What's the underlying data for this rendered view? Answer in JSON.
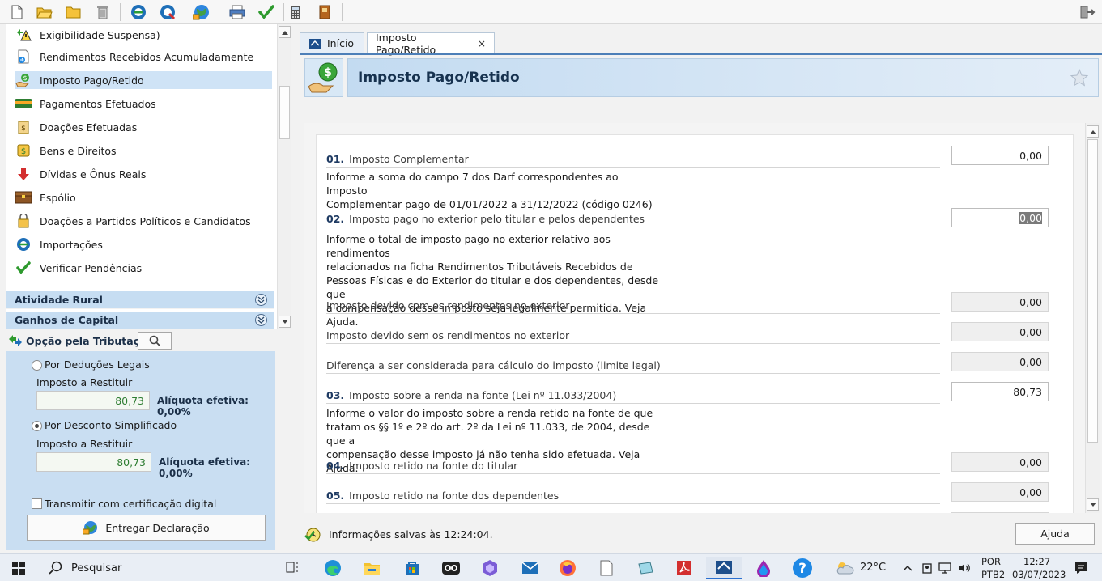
{
  "toolbar": {
    "icons": [
      "new-file-icon",
      "open-folder-icon",
      "folder-icon",
      "trash-icon",
      "receitanet-icon",
      "receitanet-alt-icon",
      "globe-icon",
      "print-icon",
      "check-icon",
      "calculator-icon",
      "book-icon",
      "exit-icon"
    ]
  },
  "nav": {
    "partial_label": "Exigibilidade Suspensa)",
    "items": [
      {
        "label": "Rendimentos Recebidos Acumuladamente"
      },
      {
        "label": "Imposto Pago/Retido"
      },
      {
        "label": "Pagamentos Efetuados"
      },
      {
        "label": "Doações Efetuadas"
      },
      {
        "label": "Bens e Direitos"
      },
      {
        "label": "Dívidas e Ônus Reais"
      },
      {
        "label": "Espólio"
      },
      {
        "label": "Doações a Partidos Políticos e Candidatos"
      },
      {
        "label": "Importações"
      },
      {
        "label": "Verificar Pendências"
      }
    ],
    "sections": [
      {
        "label": "Atividade Rural"
      },
      {
        "label": "Ganhos de Capital"
      }
    ]
  },
  "tributacao": {
    "title": "Opção pela Tributação:",
    "option1": {
      "label": "Por Deduções Legais",
      "sublabel": "Imposto a Restituir",
      "value": "80,73",
      "aliquota": "Alíquota efetiva: 0,00%"
    },
    "option2": {
      "label": "Por Desconto Simplificado",
      "sublabel": "Imposto a Restituir",
      "value": "80,73",
      "aliquota": "Alíquota efetiva: 0,00%"
    },
    "transmit_label": "Transmitir com certificação digital",
    "entregar_label": "Entregar Declaração"
  },
  "tabs": [
    {
      "label": "Início"
    },
    {
      "label": "Imposto Pago/Retido",
      "close": "×"
    }
  ],
  "page": {
    "title": "Imposto Pago/Retido"
  },
  "form": {
    "r01": {
      "num": "01.",
      "label": "Imposto Complementar",
      "value": "0,00"
    },
    "d01": [
      "Informe a soma do campo 7 dos Darf correspondentes ao Imposto",
      "Complementar pago de 01/01/2022 a 31/12/2022 (código 0246)"
    ],
    "r02": {
      "num": "02.",
      "label": "Imposto pago no exterior pelo titular e pelos dependentes",
      "value": "0,00"
    },
    "d02": [
      "Informe o total de imposto pago no exterior relativo aos rendimentos",
      "relacionados na ficha Rendimentos Tributáveis Recebidos de",
      "Pessoas Físicas e do Exterior do titular e dos dependentes, desde que",
      "a compensação desse imposto seja legalmente permitida. Veja Ajuda."
    ],
    "s1": {
      "label": "Imposto devido com os rendimentos no exterior",
      "value": "0,00"
    },
    "s2": {
      "label": "Imposto devido sem os rendimentos no exterior",
      "value": "0,00"
    },
    "s3": {
      "label": "Diferença a ser considerada para cálculo do imposto (limite legal)",
      "value": "0,00"
    },
    "r03": {
      "num": "03.",
      "label": "Imposto sobre a renda na fonte (Lei nº 11.033/2004)",
      "value": "80,73"
    },
    "d03": [
      "Informe o valor do imposto sobre a renda retido na fonte de que",
      "tratam os §§ 1º e 2º do art. 2º da Lei nº 11.033, de 2004, desde que a",
      "compensação desse imposto já não tenha sido efetuada. Veja Ajuda."
    ],
    "r04": {
      "num": "04.",
      "label": "Imposto retido na fonte do titular",
      "value": "0,00"
    },
    "r05": {
      "num": "05.",
      "label": "Imposto retido na fonte dos dependentes",
      "value": "0,00"
    }
  },
  "status": {
    "text": "Informações salvas às 12:24:04.",
    "help_label": "Ajuda"
  },
  "taskbar": {
    "search": "Pesquisar",
    "weather": "22°C",
    "lang1": "POR",
    "lang2": "PTB2",
    "time": "12:27",
    "date": "03/07/2023"
  },
  "colors": {
    "selected": "#cfe3f6",
    "section": "#c6ddf2",
    "accent": "#4d7fb8",
    "green_value": "#2e7d32"
  }
}
